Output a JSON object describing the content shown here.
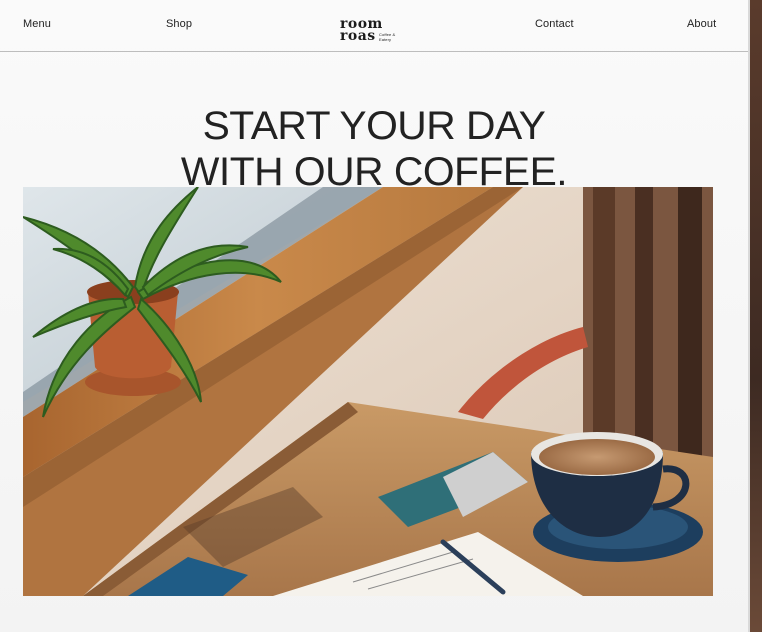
{
  "nav": {
    "left_items": [
      "Menu",
      "Shop"
    ],
    "right_items": [
      "Contact",
      "About"
    ]
  },
  "logo": {
    "line1": "room",
    "line2": "roas",
    "tagline": "Coffee & Eatery"
  },
  "hero": {
    "headline_line1": "START YOUR DAY",
    "headline_line2": "WITH OUR COFFEE."
  },
  "colors": {
    "background": "#f4f4f4",
    "text": "#222222",
    "divider": "#bdbdbd"
  }
}
